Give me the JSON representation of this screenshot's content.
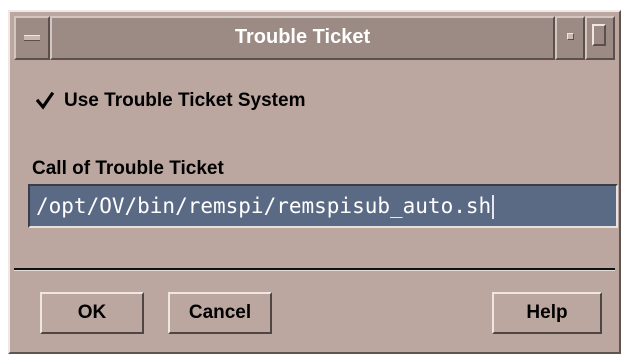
{
  "window": {
    "title": "Trouble Ticket"
  },
  "options": {
    "use_trouble_ticket_label": "Use Trouble Ticket System",
    "use_trouble_ticket_checked": true
  },
  "call_field": {
    "label": "Call of Trouble Ticket",
    "value": "/opt/OV/bin/remspi/remspisub_auto.sh"
  },
  "buttons": {
    "ok_label": "OK",
    "cancel_label": "Cancel",
    "help_label": "Help"
  },
  "icons": {
    "window_menu": "window-menu-icon",
    "minimize": "minimize-icon",
    "maximize": "maximize-icon",
    "checkmark": "checkmark-icon"
  },
  "colors": {
    "dialog_bg": "#bba79f",
    "titlebar_bg": "#9c8a85",
    "field_bg": "#5b6a84",
    "field_text": "#ffffff"
  }
}
